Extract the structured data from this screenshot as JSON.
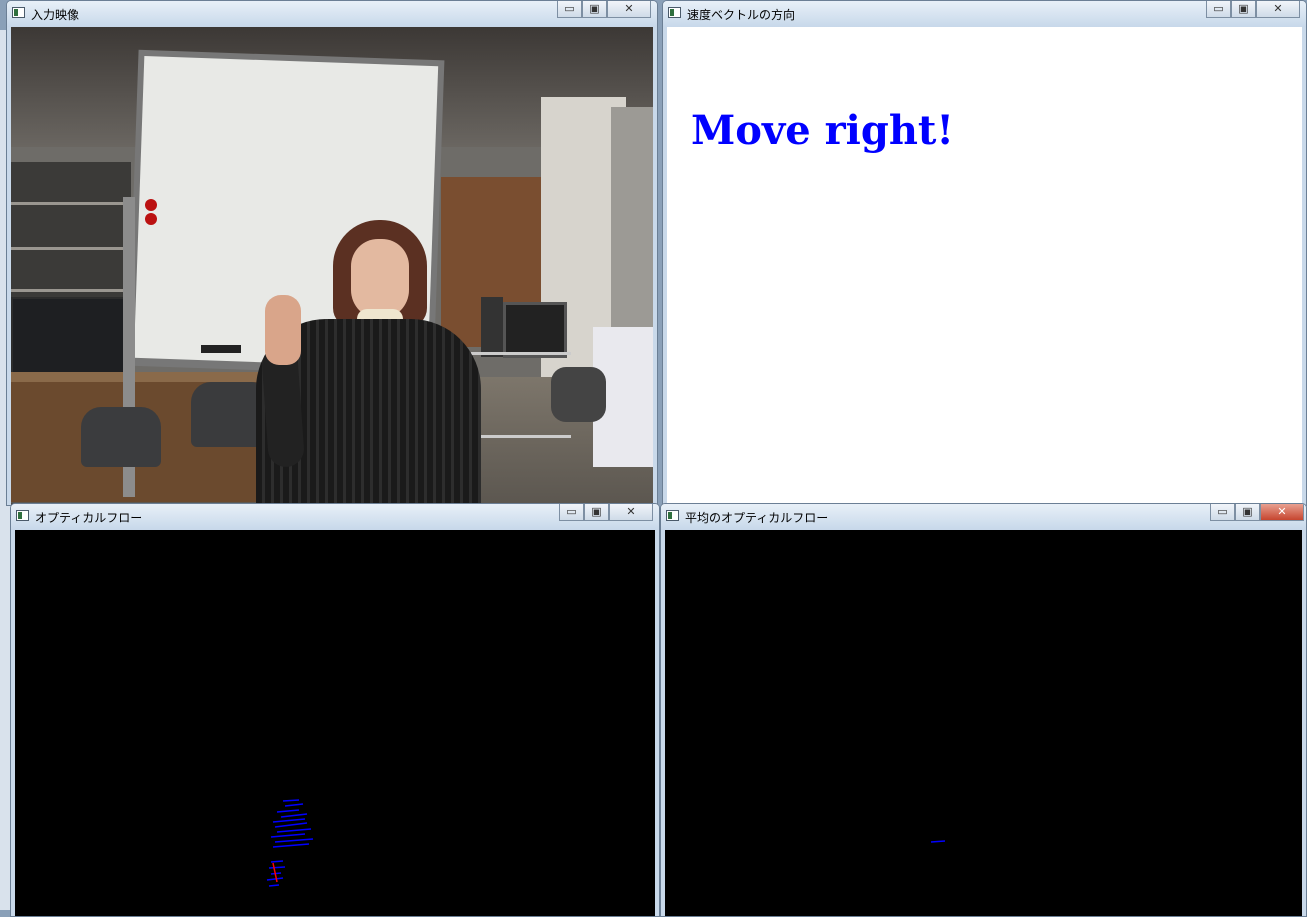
{
  "windows": {
    "input": {
      "title": "入力映像",
      "scene": "webcam-frame"
    },
    "velocity": {
      "title": "速度ベクトルの方向",
      "message": "Move right!",
      "message_color": "#0000ff"
    },
    "flow": {
      "title": "オプティカルフロー",
      "line_color": "#0000ff",
      "accent_color": "#ff0000"
    },
    "avg_flow": {
      "title": "平均のオプティカルフロー",
      "line_color": "#0000ff"
    }
  },
  "controls": {
    "minimize_glyph": "▭",
    "maximize_glyph": "▣",
    "close_glyph": "✕"
  },
  "icons": [
    "app-window-icon",
    "minimize-icon",
    "maximize-icon",
    "close-icon"
  ]
}
